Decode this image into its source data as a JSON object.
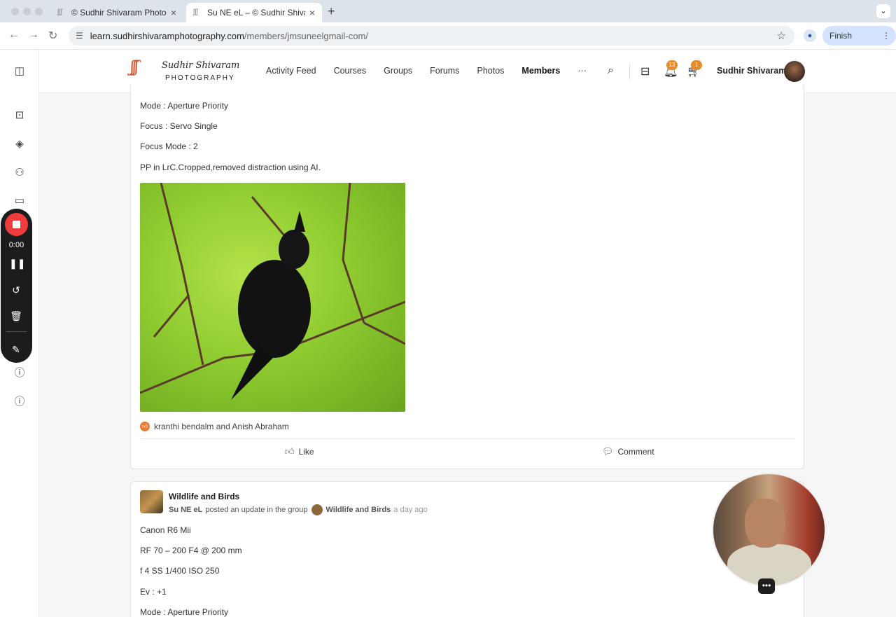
{
  "browser": {
    "tabs": [
      {
        "title": "© Sudhir Shivaram Photograp"
      },
      {
        "title": "Su NE eL – © Sudhir Shivaran"
      }
    ],
    "url_host": "learn.sudhirshivaramphotography.com",
    "url_path": "/members/jmsuneelgmail-com/",
    "finish_update_label": "Finish update"
  },
  "recorder": {
    "time": "0:00"
  },
  "site": {
    "logo_script": "Sudhir Shivaram",
    "logo_sub": "PHOTOGRAPHY",
    "nav": [
      "Activity Feed",
      "Courses",
      "Groups",
      "Forums",
      "Photos",
      "Members",
      "···"
    ],
    "active_nav": "Members",
    "notifications_count": "13",
    "cart_count": "1",
    "user_name": "Sudhir Shivaram"
  },
  "post1": {
    "lines": [
      "Mode : Aperture Priority",
      "Focus : Servo Single",
      "Focus Mode : 2",
      "PP in LrC.Cropped,removed distraction using AI."
    ],
    "reactions": "kranthi bendalm and Anish Abraham",
    "like_label": "Like",
    "comment_label": "Comment"
  },
  "post2": {
    "group_name": "Wildlife and Birds",
    "author": "Su NE eL",
    "action": "posted an update in the group",
    "group_ref": "Wildlife and Birds",
    "time_ago": "a day ago",
    "lines": [
      "Canon R6 Mii",
      "RF 70 – 200 F4 @ 200 mm",
      "f 4 SS 1/400 ISO 250",
      "Ev : +1",
      "Mode : Aperture Priority"
    ]
  },
  "colors": {
    "accent": "#3b5ccc",
    "badge": "#e98a2b",
    "record": "#ef3b3b"
  }
}
